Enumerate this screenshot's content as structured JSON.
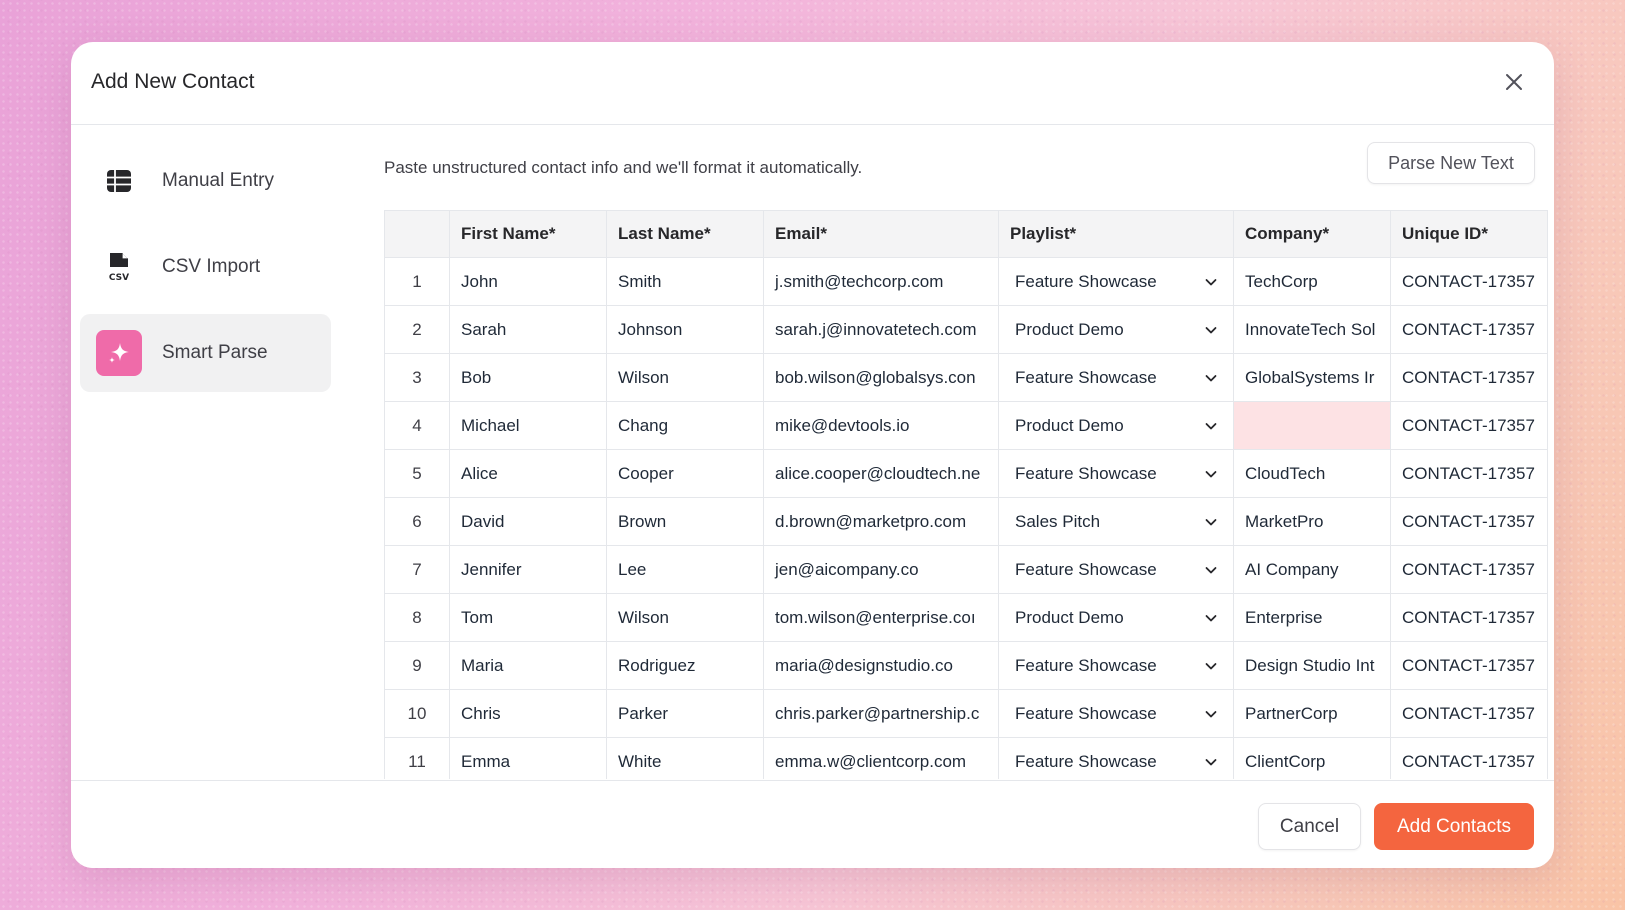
{
  "modal": {
    "title": "Add New Contact"
  },
  "sidebar": {
    "items": [
      {
        "label": "Manual Entry",
        "icon": "table-grid-icon",
        "active": false
      },
      {
        "label": "CSV Import",
        "icon": "csv-file-icon",
        "active": false
      },
      {
        "label": "Smart Parse",
        "icon": "sparkle-icon",
        "active": true
      }
    ],
    "csv_badge": "CSV"
  },
  "main": {
    "hint": "Paste unstructured contact info and we'll format it automatically.",
    "parse_new_text": "Parse New Text"
  },
  "table": {
    "columns": [
      "First Name*",
      "Last Name*",
      "Email*",
      "Playlist*",
      "Company*",
      "Unique ID*"
    ],
    "rows": [
      {
        "num": "1",
        "first": "John",
        "last": "Smith",
        "email": "j.smith@techcorp.com",
        "playlist": "Feature Showcase",
        "company": "TechCorp",
        "uid": "CONTACT-17357"
      },
      {
        "num": "2",
        "first": "Sarah",
        "last": "Johnson",
        "email": "sarah.j@innovatetech.com",
        "playlist": "Product Demo",
        "company": "InnovateTech Sol",
        "uid": "CONTACT-17357"
      },
      {
        "num": "3",
        "first": "Bob",
        "last": "Wilson",
        "email": "bob.wilson@globalsys.con",
        "playlist": "Feature Showcase",
        "company": "GlobalSystems Ir",
        "uid": "CONTACT-17357"
      },
      {
        "num": "4",
        "first": "Michael",
        "last": "Chang",
        "email": "mike@devtools.io",
        "playlist": "Product Demo",
        "company": "",
        "uid": "CONTACT-17357"
      },
      {
        "num": "5",
        "first": "Alice",
        "last": "Cooper",
        "email": "alice.cooper@cloudtech.nе",
        "playlist": "Feature Showcase",
        "company": "CloudTech",
        "uid": "CONTACT-17357"
      },
      {
        "num": "6",
        "first": "David",
        "last": "Brown",
        "email": "d.brown@marketpro.com",
        "playlist": "Sales Pitch",
        "company": "MarketPro",
        "uid": "CONTACT-17357"
      },
      {
        "num": "7",
        "first": "Jennifer",
        "last": "Lee",
        "email": "jen@aicompany.co",
        "playlist": "Feature Showcase",
        "company": "AI Company",
        "uid": "CONTACT-17357"
      },
      {
        "num": "8",
        "first": "Tom",
        "last": "Wilson",
        "email": "tom.wilson@enterprise.coı",
        "playlist": "Product Demo",
        "company": "Enterprise",
        "uid": "CONTACT-17357"
      },
      {
        "num": "9",
        "first": "Maria",
        "last": "Rodriguez",
        "email": "maria@designstudio.co",
        "playlist": "Feature Showcase",
        "company": "Design Studio Int",
        "uid": "CONTACT-17357"
      },
      {
        "num": "10",
        "first": "Chris",
        "last": "Parker",
        "email": "chris.parker@partnership.с",
        "playlist": "Feature Showcase",
        "company": "PartnerCorp",
        "uid": "CONTACT-17357"
      },
      {
        "num": "11",
        "first": "Emma",
        "last": "White",
        "email": "emma.w@clientcorp.com",
        "playlist": "Feature Showcase",
        "company": "ClientCorp",
        "uid": "CONTACT-17357"
      }
    ]
  },
  "footer": {
    "cancel": "Cancel",
    "add": "Add Contacts"
  },
  "colors": {
    "accent": "#f4653f",
    "smart_parse_icon_bg": "#ef6ba9",
    "invalid_cell": "#fde2e4"
  }
}
